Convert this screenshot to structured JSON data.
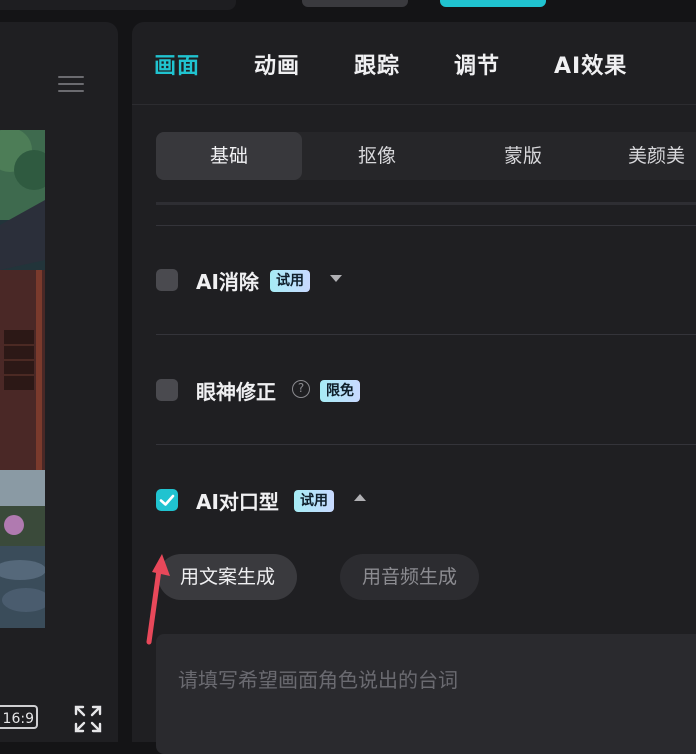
{
  "main_tabs": [
    {
      "label": "画面",
      "active": true
    },
    {
      "label": "动画",
      "active": false
    },
    {
      "label": "跟踪",
      "active": false
    },
    {
      "label": "调节",
      "active": false
    },
    {
      "label": "AI效果",
      "active": false
    }
  ],
  "sub_tabs": [
    {
      "label": "基础",
      "active": true
    },
    {
      "label": "抠像",
      "active": false
    },
    {
      "label": "蒙版",
      "active": false
    },
    {
      "label": "美颜美",
      "active": false
    }
  ],
  "features": {
    "ai_erase": {
      "label": "AI消除",
      "badge": "试用",
      "checked": false
    },
    "eye_correction": {
      "label": "眼神修正",
      "help": "?",
      "badge": "限免",
      "checked": false
    },
    "ai_lipsync": {
      "label": "AI对口型",
      "badge": "试用",
      "checked": true
    }
  },
  "generate_options": [
    {
      "label": "用文案生成",
      "active": true
    },
    {
      "label": "用音频生成",
      "active": false
    }
  ],
  "script_input": {
    "placeholder": "请填写希望画面角色说出的台词",
    "value": ""
  },
  "preview": {
    "aspect_ratio": "16:9"
  },
  "colors": {
    "accent": "#20c3d0",
    "panel": "#1f1f22",
    "background": "#141416",
    "arrow": "#e8485a"
  }
}
